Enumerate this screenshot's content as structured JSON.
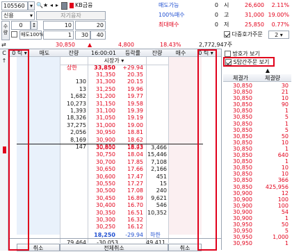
{
  "stock_code": "105560",
  "stock_name": "KB금융",
  "account_label": "신용",
  "account_name": "자기융자",
  "qty_label": "수량",
  "order_type": "매도100%",
  "order_inputs": {
    "row1": [
      "0",
      "10",
      "20"
    ],
    "row2": [
      "1",
      "30",
      "40"
    ]
  },
  "status_panel": {
    "rows": [
      {
        "label": "매도가능",
        "value": "0"
      },
      {
        "label": "100%매수",
        "value": "0"
      },
      {
        "label": "최대매수",
        "value": "0"
      }
    ]
  },
  "price_summary": [
    {
      "label": "시",
      "price": "26,600",
      "pct": "2.11%"
    },
    {
      "label": "고",
      "price": "31,000",
      "pct": "19.00%"
    },
    {
      "label": "저",
      "price": "25,850",
      "pct": "0.77%"
    }
  ],
  "multi_order": {
    "label": "다중호가주문",
    "value": "2"
  },
  "ticker": {
    "price": "30,850",
    "change": "4,800",
    "pct": "18.43%",
    "volume": "2,772,947주"
  },
  "table_header": {
    "left_tick": "0 틱",
    "sell": "매도",
    "balance": "잔량",
    "time": "16:00:01",
    "rate": "등락률",
    "balance2": "잔량",
    "buy": "매수",
    "right_tick": "0 틱"
  },
  "market_price_label": "시장가",
  "upper_limit": {
    "label": "상한",
    "price": "33,850",
    "rate": "+29.94"
  },
  "ask_rows": [
    {
      "qty": "",
      "price": "31,350",
      "rate": "20.35"
    },
    {
      "qty": "130",
      "price": "31,300",
      "rate": "20.15"
    },
    {
      "qty": "13",
      "price": "31,250",
      "rate": "19.96"
    },
    {
      "qty": "1,682",
      "price": "31,200",
      "rate": "19.77"
    },
    {
      "qty": "10,273",
      "price": "31,150",
      "rate": "19.58"
    },
    {
      "qty": "1,393",
      "price": "31,100",
      "rate": "19.39"
    },
    {
      "qty": "18,326",
      "price": "31,050",
      "rate": "19.19"
    },
    {
      "qty": "37,275",
      "price": "31,000",
      "rate": "19.00"
    },
    {
      "qty": "2,056",
      "price": "30,950",
      "rate": "18.81"
    },
    {
      "qty": "8,169",
      "price": "30,900",
      "rate": "18.62"
    },
    {
      "qty": "147",
      "price": "30,850",
      "rate": "18.43"
    }
  ],
  "bid_rows": [
    {
      "price": "30,800",
      "rate": "18.23",
      "qty": "3,466"
    },
    {
      "price": "30,750",
      "rate": "18.04",
      "qty": "15,446"
    },
    {
      "price": "30,700",
      "rate": "17.85",
      "qty": "7,108"
    },
    {
      "price": "30,650",
      "rate": "17.66",
      "qty": "2,166"
    },
    {
      "price": "30,600",
      "rate": "17.47",
      "qty": "451"
    },
    {
      "price": "30,550",
      "rate": "17.27",
      "qty": "15"
    },
    {
      "price": "30,500",
      "rate": "17.08",
      "qty": "240"
    },
    {
      "price": "30,450",
      "rate": "16.89",
      "qty": "9,621"
    },
    {
      "price": "30,400",
      "rate": "16.70",
      "qty": "546"
    },
    {
      "price": "30,350",
      "rate": "16.51",
      "qty": "10,352"
    },
    {
      "price": "30,300",
      "rate": "16.32",
      "qty": ""
    },
    {
      "price": "30,250",
      "rate": "16.12",
      "qty": ""
    }
  ],
  "lower_limit": {
    "price": "18,250",
    "rate": "-29.94",
    "label": "하한"
  },
  "totals": {
    "ask_total": "79,464",
    "diff": "-30,053",
    "bid_total": "49,411"
  },
  "bottom_buttons": {
    "cancel_left": "취소",
    "cancel_all": "전체취소",
    "cancel_right": "취소"
  },
  "checkboxes": {
    "reverse": "방호가 보기",
    "strategy": "S탑간주문 보기"
  },
  "exec_header": {
    "price": "체결가",
    "qty": "체결량"
  },
  "executions": [
    {
      "price": "30,850",
      "qty": "30"
    },
    {
      "price": "30,850",
      "qty": "21"
    },
    {
      "price": "30,850",
      "qty": "10"
    },
    {
      "price": "30,850",
      "qty": "90"
    },
    {
      "price": "30,850",
      "qty": "1"
    },
    {
      "price": "30,850",
      "qty": "5"
    },
    {
      "price": "30,850",
      "qty": "1"
    },
    {
      "price": "30,850",
      "qty": "5"
    },
    {
      "price": "30,850",
      "qty": "50"
    },
    {
      "price": "30,850",
      "qty": "10"
    },
    {
      "price": "30,850",
      "qty": "1"
    },
    {
      "price": "30,850",
      "qty": "640"
    },
    {
      "price": "30,850",
      "qty": "1"
    },
    {
      "price": "30,850",
      "qty": "10"
    },
    {
      "price": "30,850",
      "qty": "10"
    },
    {
      "price": "30,850",
      "qty": "366"
    },
    {
      "price": "30,850",
      "qty": "425,956"
    },
    {
      "price": "30,900",
      "qty": "12"
    },
    {
      "price": "30,900",
      "qty": "100"
    },
    {
      "price": "30,900",
      "qty": "100"
    },
    {
      "price": "30,900",
      "qty": "54"
    },
    {
      "price": "30,900",
      "qty": "1"
    },
    {
      "price": "30,950",
      "qty": "50"
    },
    {
      "price": "30,950",
      "qty": "5"
    },
    {
      "price": "30,950",
      "qty": "1,000"
    },
    {
      "price": "30,950",
      "qty": "1"
    }
  ],
  "colors": {
    "accent_red": "#e0001b",
    "sell_bg": "#e9f1fb",
    "buy_bg": "#fbeff1",
    "price_red": "#e2001a",
    "price_blue": "#1f4fd1"
  }
}
